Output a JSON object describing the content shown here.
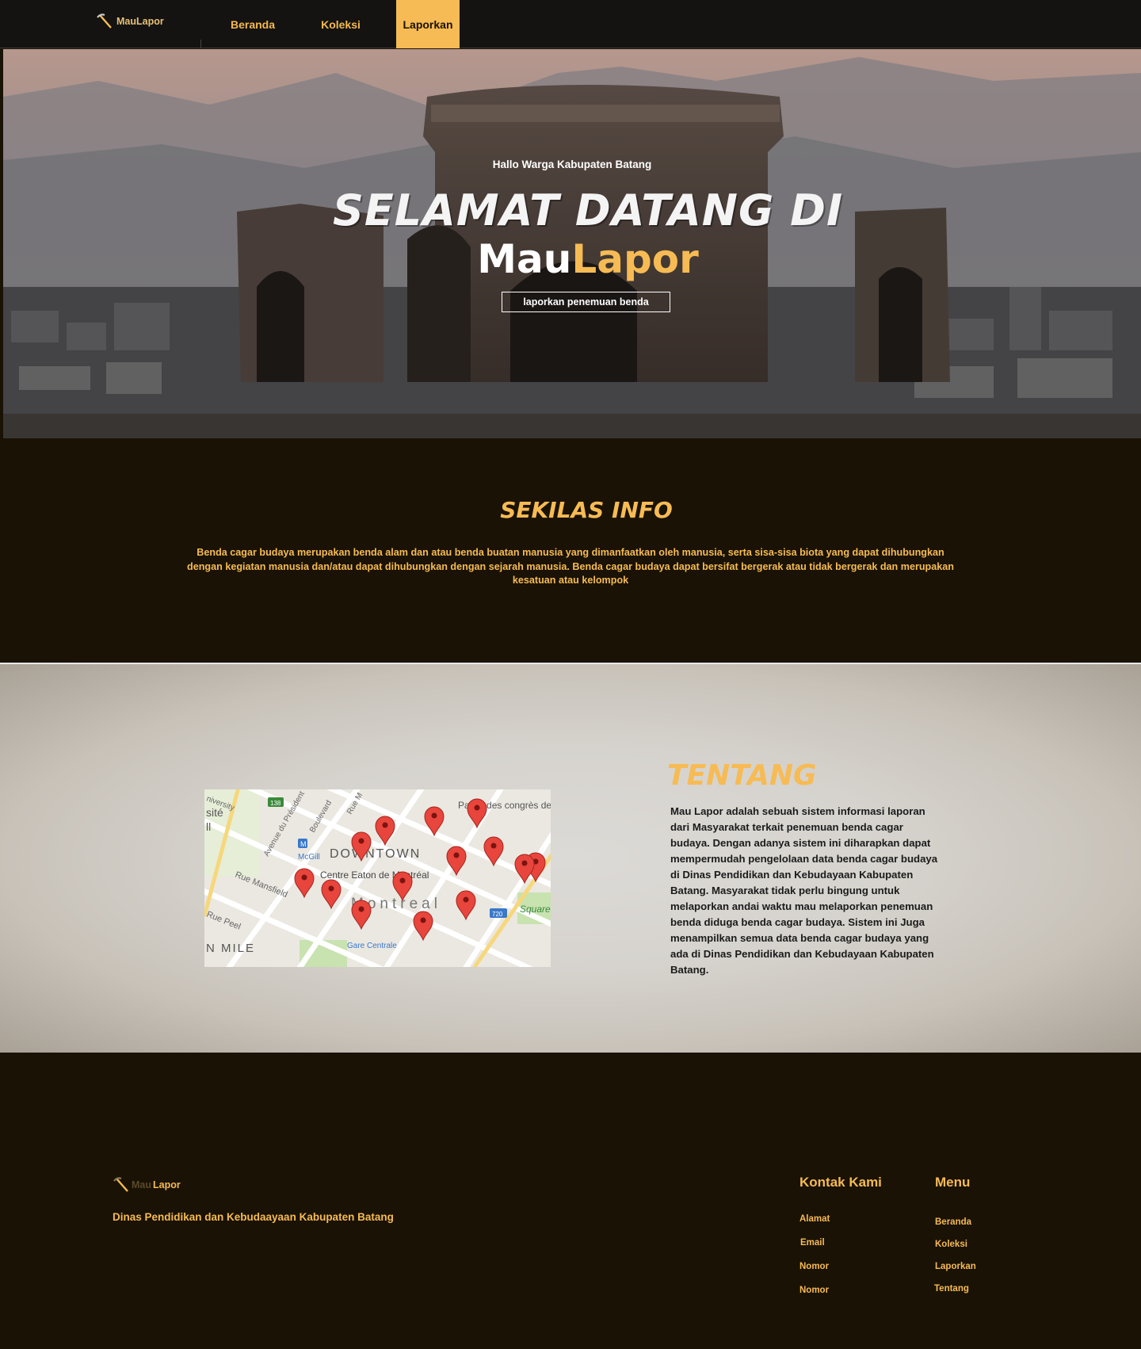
{
  "nav": {
    "brand": "MauLapor",
    "items": [
      {
        "label": "Beranda"
      },
      {
        "label": "Koleksi"
      },
      {
        "label": "Laporkan"
      }
    ]
  },
  "hero": {
    "subtitle": "Hallo Warga Kabupaten Batang",
    "title": "SELAMAT DATANG DI",
    "brand_part1": "Mau",
    "brand_part2": "Lapor",
    "button_label": "laporkan penemuan benda"
  },
  "info": {
    "title": "SEKILAS INFO",
    "text": "Benda cagar budaya merupakan benda alam dan atau benda buatan manusia  yang dimanfaatkan oleh manusia, serta sisa-sisa biota yang dapat dihubungkan dengan kegiatan manusia dan/atau dapat dihubungkan dengan sejarah manusia. Benda cagar budaya dapat bersifat bergerak atau tidak bergerak dan  merupakan kesatuan atau kelompok"
  },
  "about": {
    "title": "TENTANG",
    "text": "Mau Lapor adalah sebuah sistem informasi laporan dari Masyarakat terkait penemuan benda cagar budaya. Dengan adanya sistem ini diharapkan dapat mempermudah pengelolaan data benda cagar budaya di Dinas Pendidikan dan Kebudayaan Kabupaten Batang. Masyarakat tidak perlu bingung untuk melaporkan andai waktu mau melaporkan penemuan benda diduga benda cagar budaya. Sistem ini Juga menampilkan semua data benda cagar budaya yang ada di Dinas Pendidikan dan Kebudayaan Kabupaten Batang.",
    "map": {
      "labels": {
        "downtown": "DOWNTOWN",
        "montreal": "Montreal",
        "centre_eaton": "Centre Eaton de Montréal",
        "gare": "Gare Centrale",
        "mcgill": "McGill",
        "rue_mansfield": "Rue Mansfield",
        "rue_peel": "Rue Peel",
        "avenue": "Avenue du Président",
        "boulevard": "Boulevard",
        "rue": "Rue M",
        "university": "niversity",
        "site": "sité",
        "ll": "ll",
        "palais": "Palais des congrès de Montréal",
        "square": "Square Victor",
        "n_mile": "N MILE",
        "route_138": "138",
        "route_720": "720",
        "metro": "M"
      },
      "marker_count": 14
    }
  },
  "footer": {
    "brand_part1": "Mau",
    "brand_part2": "Lapor",
    "org": "Dinas Pendidikan dan Kebudaayaan  Kabupaten Batang",
    "contact_title": "Kontak Kami",
    "contact_items": [
      "Alamat",
      "Email",
      "Nomor",
      "Nomor"
    ],
    "menu_title": "Menu",
    "menu_items": [
      "Beranda",
      "Koleksi",
      "Laporkan",
      "Tentang"
    ]
  },
  "colors": {
    "accent": "#f6bb54",
    "nav_bg": "#141311",
    "dark_bg": "#1a1205"
  }
}
